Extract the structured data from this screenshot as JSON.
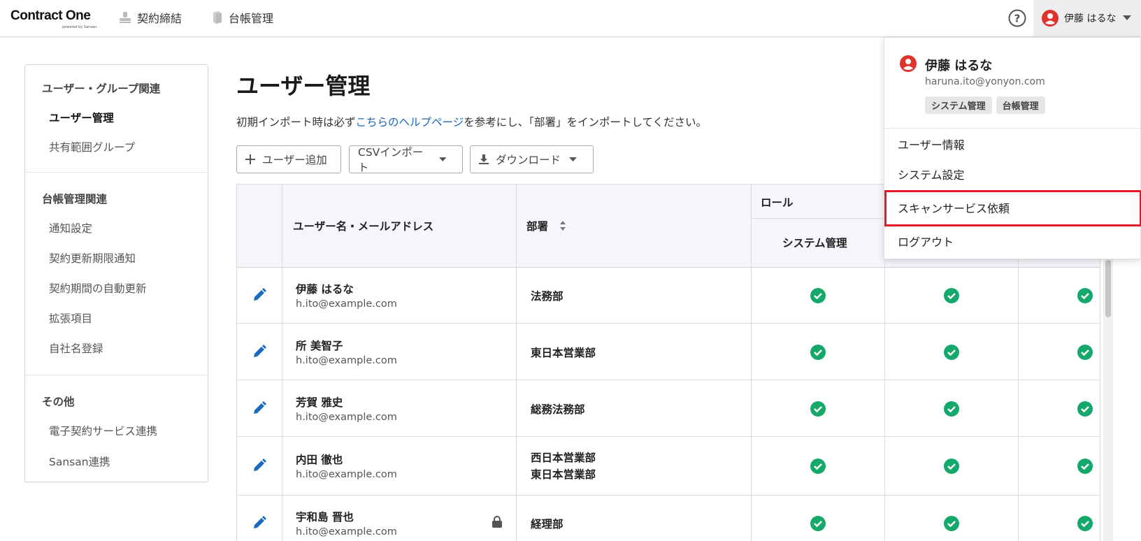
{
  "header": {
    "logo": "Contract One",
    "logo_sub": "powered by Sansan",
    "nav": [
      "契約締結",
      "台帳管理"
    ],
    "user_name": "伊藤 はるな"
  },
  "sidebar": {
    "groups": [
      {
        "title": "ユーザー・グループ関連",
        "items": [
          "ユーザー管理",
          "共有範囲グループ"
        ]
      },
      {
        "title": "台帳管理関連",
        "items": [
          "通知設定",
          "契約更新期限通知",
          "契約期間の自動更新",
          "拡張項目",
          "自社名登録"
        ]
      },
      {
        "title": "その他",
        "items": [
          "電子契約サービス連携",
          "Sansan連携"
        ]
      }
    ],
    "active_item": "ユーザー管理"
  },
  "main": {
    "title": "ユーザー管理",
    "notice_prefix": "初期インポート時は必ず",
    "notice_link": "こちらのヘルプページ",
    "notice_suffix": "を参考にし、「部署」をインポートしてください。",
    "toolbar": {
      "add_user": "ユーザー追加",
      "csv_import": "CSVインポート",
      "download": "ダウンロード"
    }
  },
  "table": {
    "headers": {
      "name": "ユーザー名・メールアドレス",
      "dept": "部署",
      "role": "ロール",
      "system_admin": "システム管理"
    },
    "rows": [
      {
        "name": "伊藤 はるな",
        "email": "h.ito@example.com",
        "dept": [
          "法務部"
        ],
        "locked": false
      },
      {
        "name": "所 美智子",
        "email": "h.ito@example.com",
        "dept": [
          "東日本営業部"
        ],
        "locked": false
      },
      {
        "name": "芳賀 雅史",
        "email": "h.ito@example.com",
        "dept": [
          "総務法務部"
        ],
        "locked": false
      },
      {
        "name": "内田 徹也",
        "email": "h.ito@example.com",
        "dept": [
          "西日本営業部",
          "東日本営業部"
        ],
        "locked": false
      },
      {
        "name": "宇和島 晋也",
        "email": "h.ito@example.com",
        "dept": [
          "経理部"
        ],
        "locked": true
      }
    ]
  },
  "dropdown": {
    "name": "伊藤 はるな",
    "email": "haruna.ito@yonyon.com",
    "tags": [
      "システム管理",
      "台帳管理"
    ],
    "items": [
      "ユーザー情報",
      "システム設定",
      "スキャンサービス依頼",
      "ログアウト"
    ],
    "highlighted_item": "スキャンサービス依頼"
  },
  "colors": {
    "accent_link": "#1767c2",
    "check_green": "#14a86a",
    "avatar_red": "#e0332e",
    "highlight_red": "#e21b27",
    "edit_blue": "#1a6bbf"
  }
}
